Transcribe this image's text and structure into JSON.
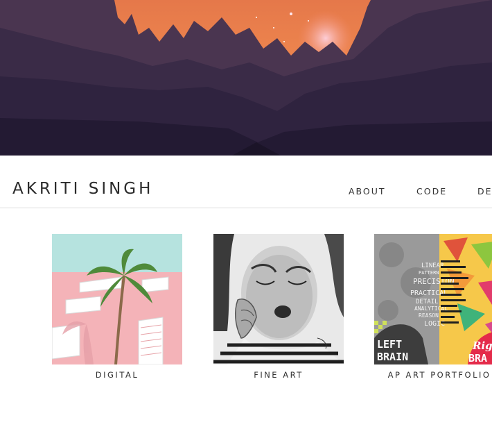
{
  "header": {
    "title": "AKRITI SINGH"
  },
  "nav": {
    "items": [
      "ABOUT",
      "CODE",
      "DE"
    ]
  },
  "gallery": {
    "items": [
      {
        "caption": "DIGITAL"
      },
      {
        "caption": "FINE ART"
      },
      {
        "caption": "AP ART PORTFOLIO",
        "artwork_text": [
          "LEFT",
          "BRAIN",
          "Rig",
          "BRA",
          "LINEAR",
          "PATTERN",
          "PRECISION",
          "PRACTICAL",
          "DETAIL",
          "ANALYTICAL",
          "REASON",
          "LOGIC"
        ]
      }
    ]
  },
  "colors": {
    "hero_sky": "#e5784a",
    "hero_dark": "#221a35",
    "text": "#2b2b2b",
    "divider": "#dcdcdc"
  }
}
